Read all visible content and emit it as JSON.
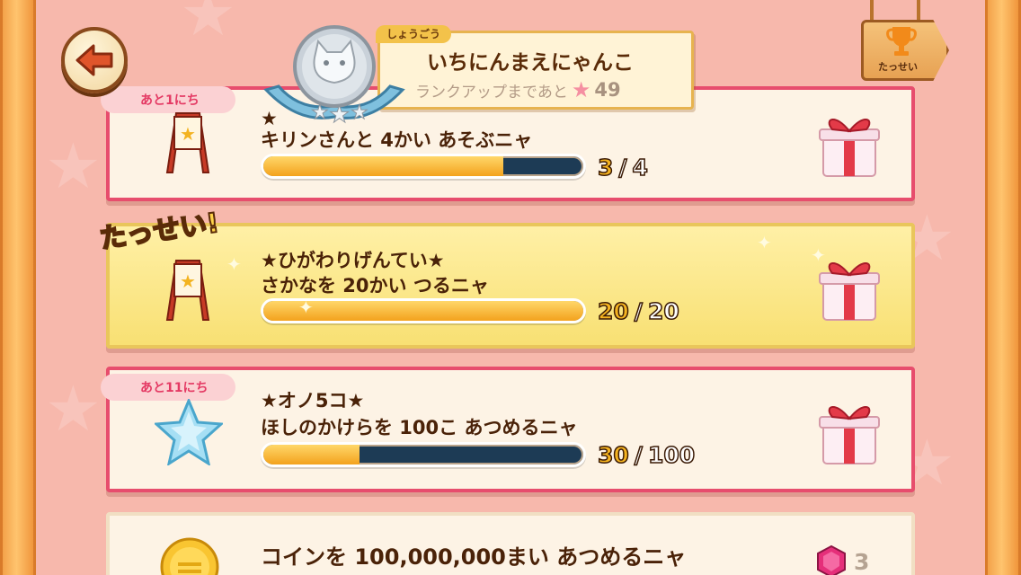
{
  "header": {
    "rank_tag": "しょうごう",
    "rank_name": "いちにんまえにゃんこ",
    "rank_next_label": "ランクアップまであと",
    "rank_next_value": "49",
    "trophy_label": "たっせい"
  },
  "missions": [
    {
      "timer": "あと1にち",
      "title": "★",
      "desc": "キリンさんと 4かい あそぶニャ",
      "current": "3",
      "total": "4",
      "progress": 0.75,
      "icon": "signboard-icon"
    },
    {
      "badge": "たっせい!",
      "title": "★ひがわりげんてい★",
      "desc": "さかなを 20かい つるニャ",
      "current": "20",
      "total": "20",
      "progress": 1.0,
      "icon": "signboard-icon"
    },
    {
      "timer": "あと11にち",
      "title": "★オノ5コ★",
      "desc": "ほしのかけらを 100こ あつめるニャ",
      "current": "30",
      "total": "100",
      "progress": 0.3,
      "icon": "star-icon"
    },
    {
      "desc": "コインを 100,000,000まい あつめるニャ",
      "reward_count": "3",
      "icon": "coin-icon"
    }
  ],
  "counter_sep": "/",
  "colors": {
    "card_border_active": "#e74d6d",
    "card_border_done": "#e9c65b",
    "progress_fill": "#f3a21d",
    "progress_track": "#1d3b55"
  }
}
